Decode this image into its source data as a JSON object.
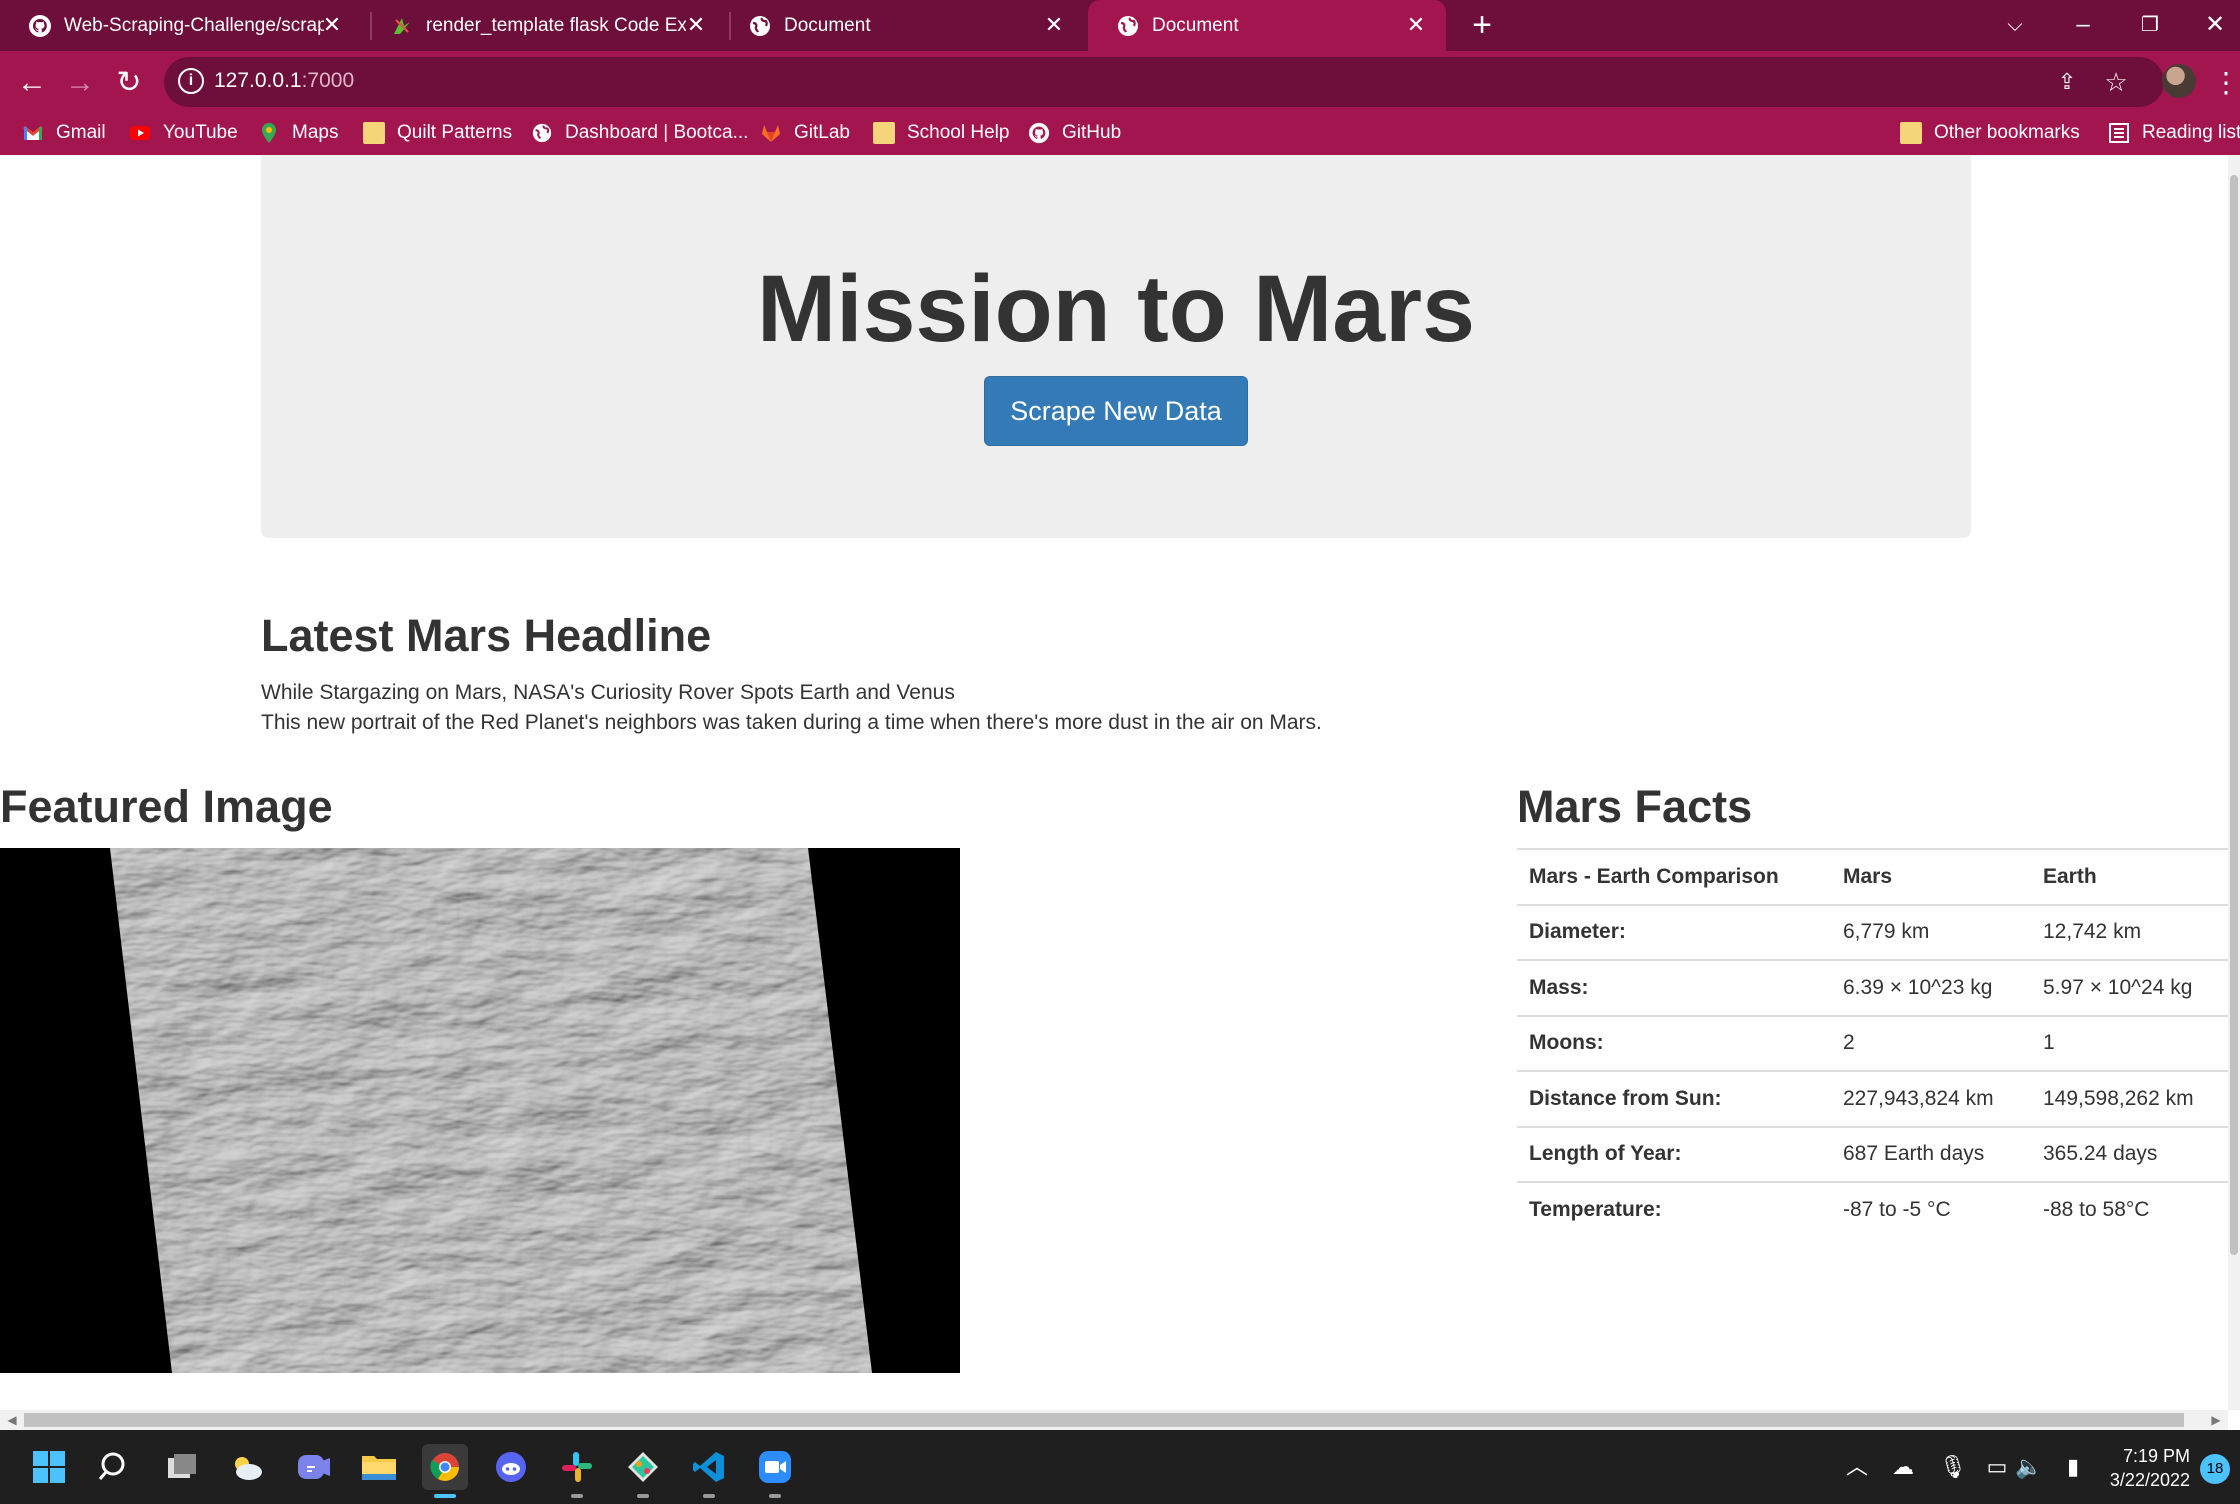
{
  "browser": {
    "tabs": [
      {
        "title": "Web-Scraping-Challenge/scrape_",
        "icon": "github-icon"
      },
      {
        "title": "render_template flask Code Exam",
        "icon": "codegrepper-icon"
      },
      {
        "title": "Document",
        "icon": "globe-icon"
      },
      {
        "title": "Document",
        "icon": "globe-icon",
        "active": true
      }
    ],
    "url_host": "127.0.0.1",
    "url_port": ":7000",
    "bookmarks": [
      {
        "label": "Gmail",
        "icon": "gmail-icon"
      },
      {
        "label": "YouTube",
        "icon": "youtube-icon"
      },
      {
        "label": "Maps",
        "icon": "maps-icon"
      },
      {
        "label": "Quilt Patterns",
        "icon": "folder-icon"
      },
      {
        "label": "Dashboard | Bootca...",
        "icon": "globe-icon"
      },
      {
        "label": "GitLab",
        "icon": "gitlab-icon"
      },
      {
        "label": "School Help",
        "icon": "folder-icon"
      },
      {
        "label": "GitHub",
        "icon": "github-icon"
      }
    ],
    "other_bookmarks": "Other bookmarks",
    "reading_list": "Reading list",
    "accent": "#a3154f",
    "tabstrip_color": "#6d0f3a"
  },
  "page": {
    "title": "Mission to Mars",
    "scrape_button": "Scrape New Data",
    "headline_heading": "Latest Mars Headline",
    "news_title": "While Stargazing on Mars, NASA's Curiosity Rover Spots Earth and Venus",
    "news_paragraph": "This new portrait of the Red Planet's neighbors was taken during a time when there's more dust in the air on Mars.",
    "featured_heading": "Featured Image",
    "facts_heading": "Mars Facts",
    "facts_table": {
      "headers": [
        "Mars - Earth Comparison",
        "Mars",
        "Earth"
      ],
      "rows": [
        [
          "Diameter:",
          "6,779 km",
          "12,742 km"
        ],
        [
          "Mass:",
          "6.39 × 10^23 kg",
          "5.97 × 10^24 kg"
        ],
        [
          "Moons:",
          "2",
          "1"
        ],
        [
          "Distance from Sun:",
          "227,943,824 km",
          "149,598,262 km"
        ],
        [
          "Length of Year:",
          "687 Earth days",
          "365.24 days"
        ],
        [
          "Temperature:",
          "-87 to -5 °C",
          "-88 to 58°C"
        ]
      ]
    },
    "button_color": "#337ab7"
  },
  "taskbar": {
    "apps": [
      "start-icon",
      "search-icon",
      "task-view-icon",
      "weather-icon",
      "teams-icon",
      "file-explorer-icon",
      "chrome-icon",
      "discord-icon",
      "slack-icon",
      "gitkraken-icon",
      "vscode-icon",
      "zoom-icon"
    ],
    "time": "7:19 PM",
    "date": "3/22/2022",
    "notification_count": "18"
  }
}
